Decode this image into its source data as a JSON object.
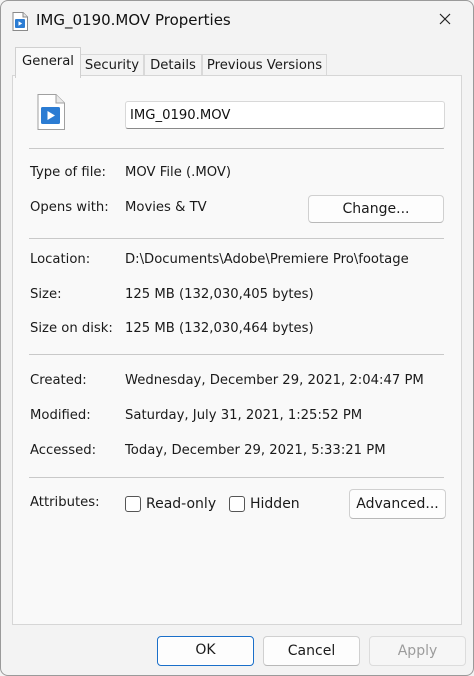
{
  "window": {
    "title": "IMG_0190.MOV Properties"
  },
  "tabs": [
    {
      "label": "General"
    },
    {
      "label": "Security"
    },
    {
      "label": "Details"
    },
    {
      "label": "Previous Versions"
    }
  ],
  "general": {
    "file_name": "IMG_0190.MOV",
    "type_of_file": {
      "label": "Type of file:",
      "value": "MOV File (.MOV)"
    },
    "opens_with": {
      "label": "Opens with:",
      "value": "Movies & TV",
      "button": "Change..."
    },
    "location": {
      "label": "Location:",
      "value": "D:\\Documents\\Adobe\\Premiere Pro\\footage"
    },
    "size": {
      "label": "Size:",
      "value": "125 MB (132,030,405 bytes)"
    },
    "size_on_disk": {
      "label": "Size on disk:",
      "value": "125 MB (132,030,464 bytes)"
    },
    "created": {
      "label": "Created:",
      "value": "Wednesday, December 29, 2021, 2:04:47 PM"
    },
    "modified": {
      "label": "Modified:",
      "value": "Saturday, July 31, 2021, 1:25:52 PM"
    },
    "accessed": {
      "label": "Accessed:",
      "value": "Today, December 29, 2021, 5:33:21 PM"
    },
    "attributes": {
      "label": "Attributes:",
      "read_only": {
        "label": "Read-only",
        "checked": false
      },
      "hidden": {
        "label": "Hidden",
        "checked": false
      },
      "advanced_button": "Advanced..."
    }
  },
  "footer": {
    "ok": "OK",
    "cancel": "Cancel",
    "apply": "Apply"
  },
  "icons": {
    "title_icon": "video-file-icon",
    "file_icon": "video-file-icon",
    "close": "close-icon"
  },
  "colors": {
    "accent": "#1a6fc9",
    "video_icon_blue": "#2b7cd3"
  }
}
